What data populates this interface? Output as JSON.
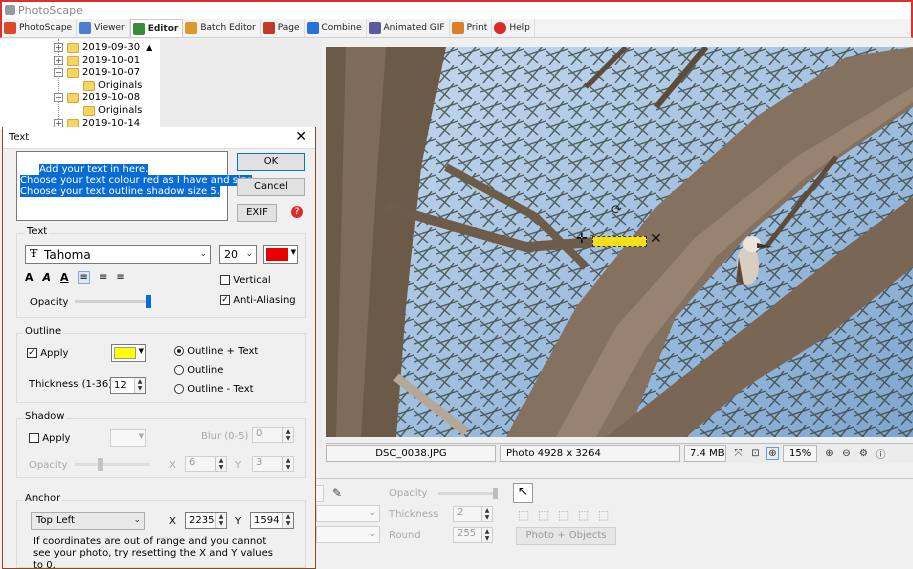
{
  "app": {
    "title": "PhotoScape"
  },
  "tabs": [
    {
      "label": "PhotoScape",
      "icon": "photoscape-icon",
      "color": "#d94a2b"
    },
    {
      "label": "Viewer",
      "icon": "viewer-icon",
      "color": "#4a7fcf"
    },
    {
      "label": "Editor",
      "icon": "editor-icon",
      "color": "#3b8a3b"
    },
    {
      "label": "Batch Editor",
      "icon": "batch-editor-icon",
      "color": "#d99a2b"
    },
    {
      "label": "Page",
      "icon": "page-icon",
      "color": "#c0392b"
    },
    {
      "label": "Combine",
      "icon": "combine-icon",
      "color": "#2b6fd9"
    },
    {
      "label": "Animated GIF",
      "icon": "animated-gif-icon",
      "color": "#5a5aa0"
    },
    {
      "label": "Print",
      "icon": "print-icon",
      "color": "#d9802b"
    },
    {
      "label": "Help",
      "icon": "help-icon",
      "color": "#d92b2b"
    }
  ],
  "active_tab": "Editor",
  "tree": {
    "items": [
      {
        "label": "2019-09-30",
        "type": "folder",
        "expander": "+"
      },
      {
        "label": "2019-10-01",
        "type": "folder",
        "expander": "+"
      },
      {
        "label": "2019-10-07",
        "type": "folder",
        "expander": "-"
      },
      {
        "label": "Originals",
        "type": "subfolder"
      },
      {
        "label": "2019-10-08",
        "type": "folder",
        "expander": "-"
      },
      {
        "label": "Originals",
        "type": "subfolder"
      },
      {
        "label": "2019-10-14",
        "type": "folder",
        "expander": "+"
      }
    ]
  },
  "status": {
    "filename": "DSC_0038.JPG",
    "dimensions": "Photo 4928 x 3264",
    "filesize": "7.4 MB",
    "zoom": "15%"
  },
  "bottom_panel": {
    "opacity_label": "Opacity",
    "thickness_label": "Thickness",
    "thickness_value": "2",
    "round_label": "Round",
    "round_value": "255",
    "photo_objects_button": "Photo + Objects"
  },
  "dialog": {
    "title": "Text",
    "text_content": "Add your text in here.\nChoose your text colour red as I have and size\nChoose your text outline shadow size 5.",
    "ok_label": "OK",
    "cancel_label": "Cancel",
    "exif_label": "EXIF",
    "text_section": {
      "label": "Text",
      "font": "Tahoma",
      "size": "20",
      "color": "#e60000",
      "vertical_label": "Vertical",
      "vertical_checked": false,
      "antialias_label": "Anti-Aliasing",
      "antialias_checked": true,
      "opacity_label": "Opacity"
    },
    "outline_section": {
      "label": "Outline",
      "apply_label": "Apply",
      "apply_checked": true,
      "color": "#ffff00",
      "thickness_label": "Thickness (1-36)",
      "thickness_value": "12",
      "options": [
        "Outline + Text",
        "Outline",
        "Outline - Text"
      ],
      "selected": "Outline + Text"
    },
    "shadow_section": {
      "label": "Shadow",
      "apply_label": "Apply",
      "apply_checked": false,
      "blur_label": "Blur (0-5)",
      "blur_value": "0",
      "opacity_label": "Opacity",
      "x_label": "X",
      "x_value": "6",
      "y_label": "Y",
      "y_value": "3"
    },
    "anchor_section": {
      "label": "Anchor",
      "anchor_value": "Top Left",
      "x_label": "X",
      "x_value": "2235",
      "y_label": "Y",
      "y_value": "1594",
      "note": "If coordinates are out of range and you cannot see your photo, try resetting the X and Y values to 0."
    }
  }
}
